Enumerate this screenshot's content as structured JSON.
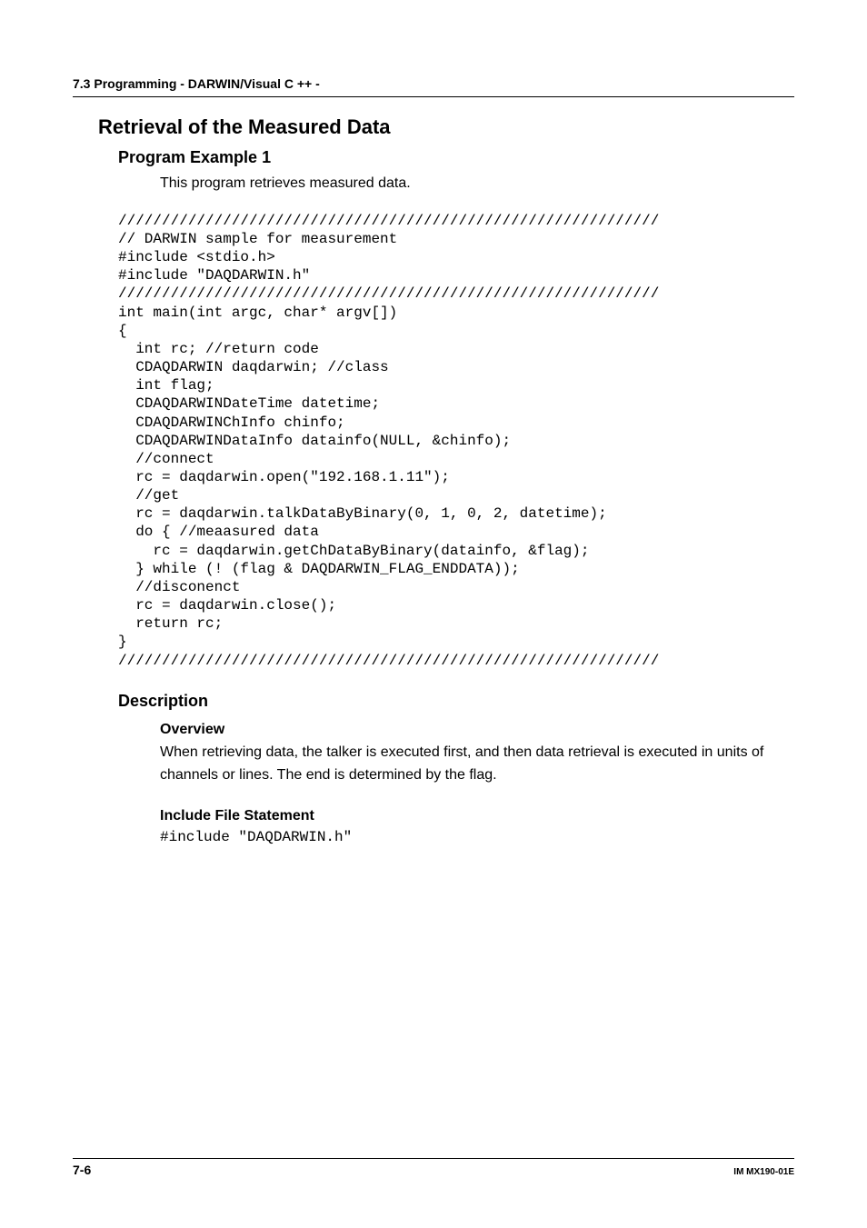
{
  "header": {
    "section": "7.3  Programming - DARWIN/Visual C ++ -"
  },
  "title": "Retrieval of the Measured Data",
  "example": {
    "heading": "Program Example 1",
    "intro": "This program retrieves measured data.",
    "code": "//////////////////////////////////////////////////////////////\n// DARWIN sample for measurement\n#include <stdio.h>\n#include \"DAQDARWIN.h\"\n//////////////////////////////////////////////////////////////\nint main(int argc, char* argv[])\n{\n  int rc; //return code\n  CDAQDARWIN daqdarwin; //class\n  int flag;\n  CDAQDARWINDateTime datetime;\n  CDAQDARWINChInfo chinfo;\n  CDAQDARWINDataInfo datainfo(NULL, &chinfo);\n  //connect\n  rc = daqdarwin.open(\"192.168.1.11\");\n  //get\n  rc = daqdarwin.talkDataByBinary(0, 1, 0, 2, datetime);\n  do { //meaasured data\n    rc = daqdarwin.getChDataByBinary(datainfo, &flag);\n  } while (! (flag & DAQDARWIN_FLAG_ENDDATA));\n  //disconenct\n  rc = daqdarwin.close();\n  return rc;\n}\n//////////////////////////////////////////////////////////////"
  },
  "description": {
    "heading": "Description",
    "overview": {
      "heading": "Overview",
      "text": "When retrieving data, the talker is executed first, and then data retrieval is executed in units of channels or lines. The end is determined by the flag."
    },
    "include": {
      "heading": "Include File Statement",
      "code": "#include \"DAQDARWIN.h\""
    }
  },
  "footer": {
    "page": "7-6",
    "doc": "IM MX190-01E"
  }
}
